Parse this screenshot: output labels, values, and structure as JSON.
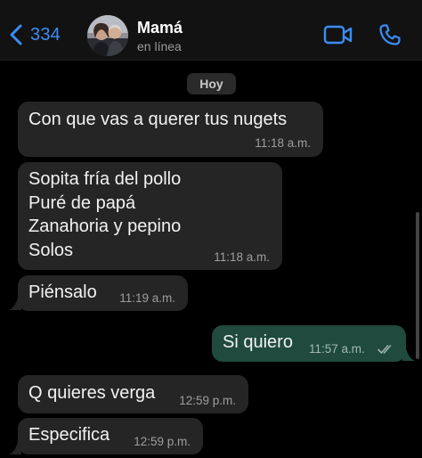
{
  "header": {
    "back_count": "334",
    "contact_name": "Mamá",
    "contact_status": "en línea"
  },
  "icons": {
    "back": "chevron-left-icon",
    "video": "video-camera-icon",
    "call": "phone-icon",
    "read_receipt": "double-check-icon"
  },
  "colors": {
    "accent": "#3a8ef6",
    "incoming_bubble": "#252525",
    "outgoing_bubble": "#1f4a3d",
    "background": "#000000"
  },
  "chat": {
    "date_label": "Hoy",
    "messages": [
      {
        "direction": "in",
        "text": "Con que vas a querer tus nugets",
        "time": "11:18 a.m."
      },
      {
        "direction": "in",
        "text": "Sopita fría del pollo\nPuré de papá\nZanahoria y pepino\nSolos",
        "time": "11:18 a.m."
      },
      {
        "direction": "in",
        "text": "Piénsalo",
        "time": "11:19 a.m."
      },
      {
        "direction": "out",
        "text": "Si quiero",
        "time": "11:57 a.m.",
        "status": "read"
      },
      {
        "direction": "in",
        "text": "Q quieres verga",
        "time": "12:59 p.m."
      },
      {
        "direction": "in",
        "text": "Especifica",
        "time": "12:59 p.m."
      }
    ]
  }
}
